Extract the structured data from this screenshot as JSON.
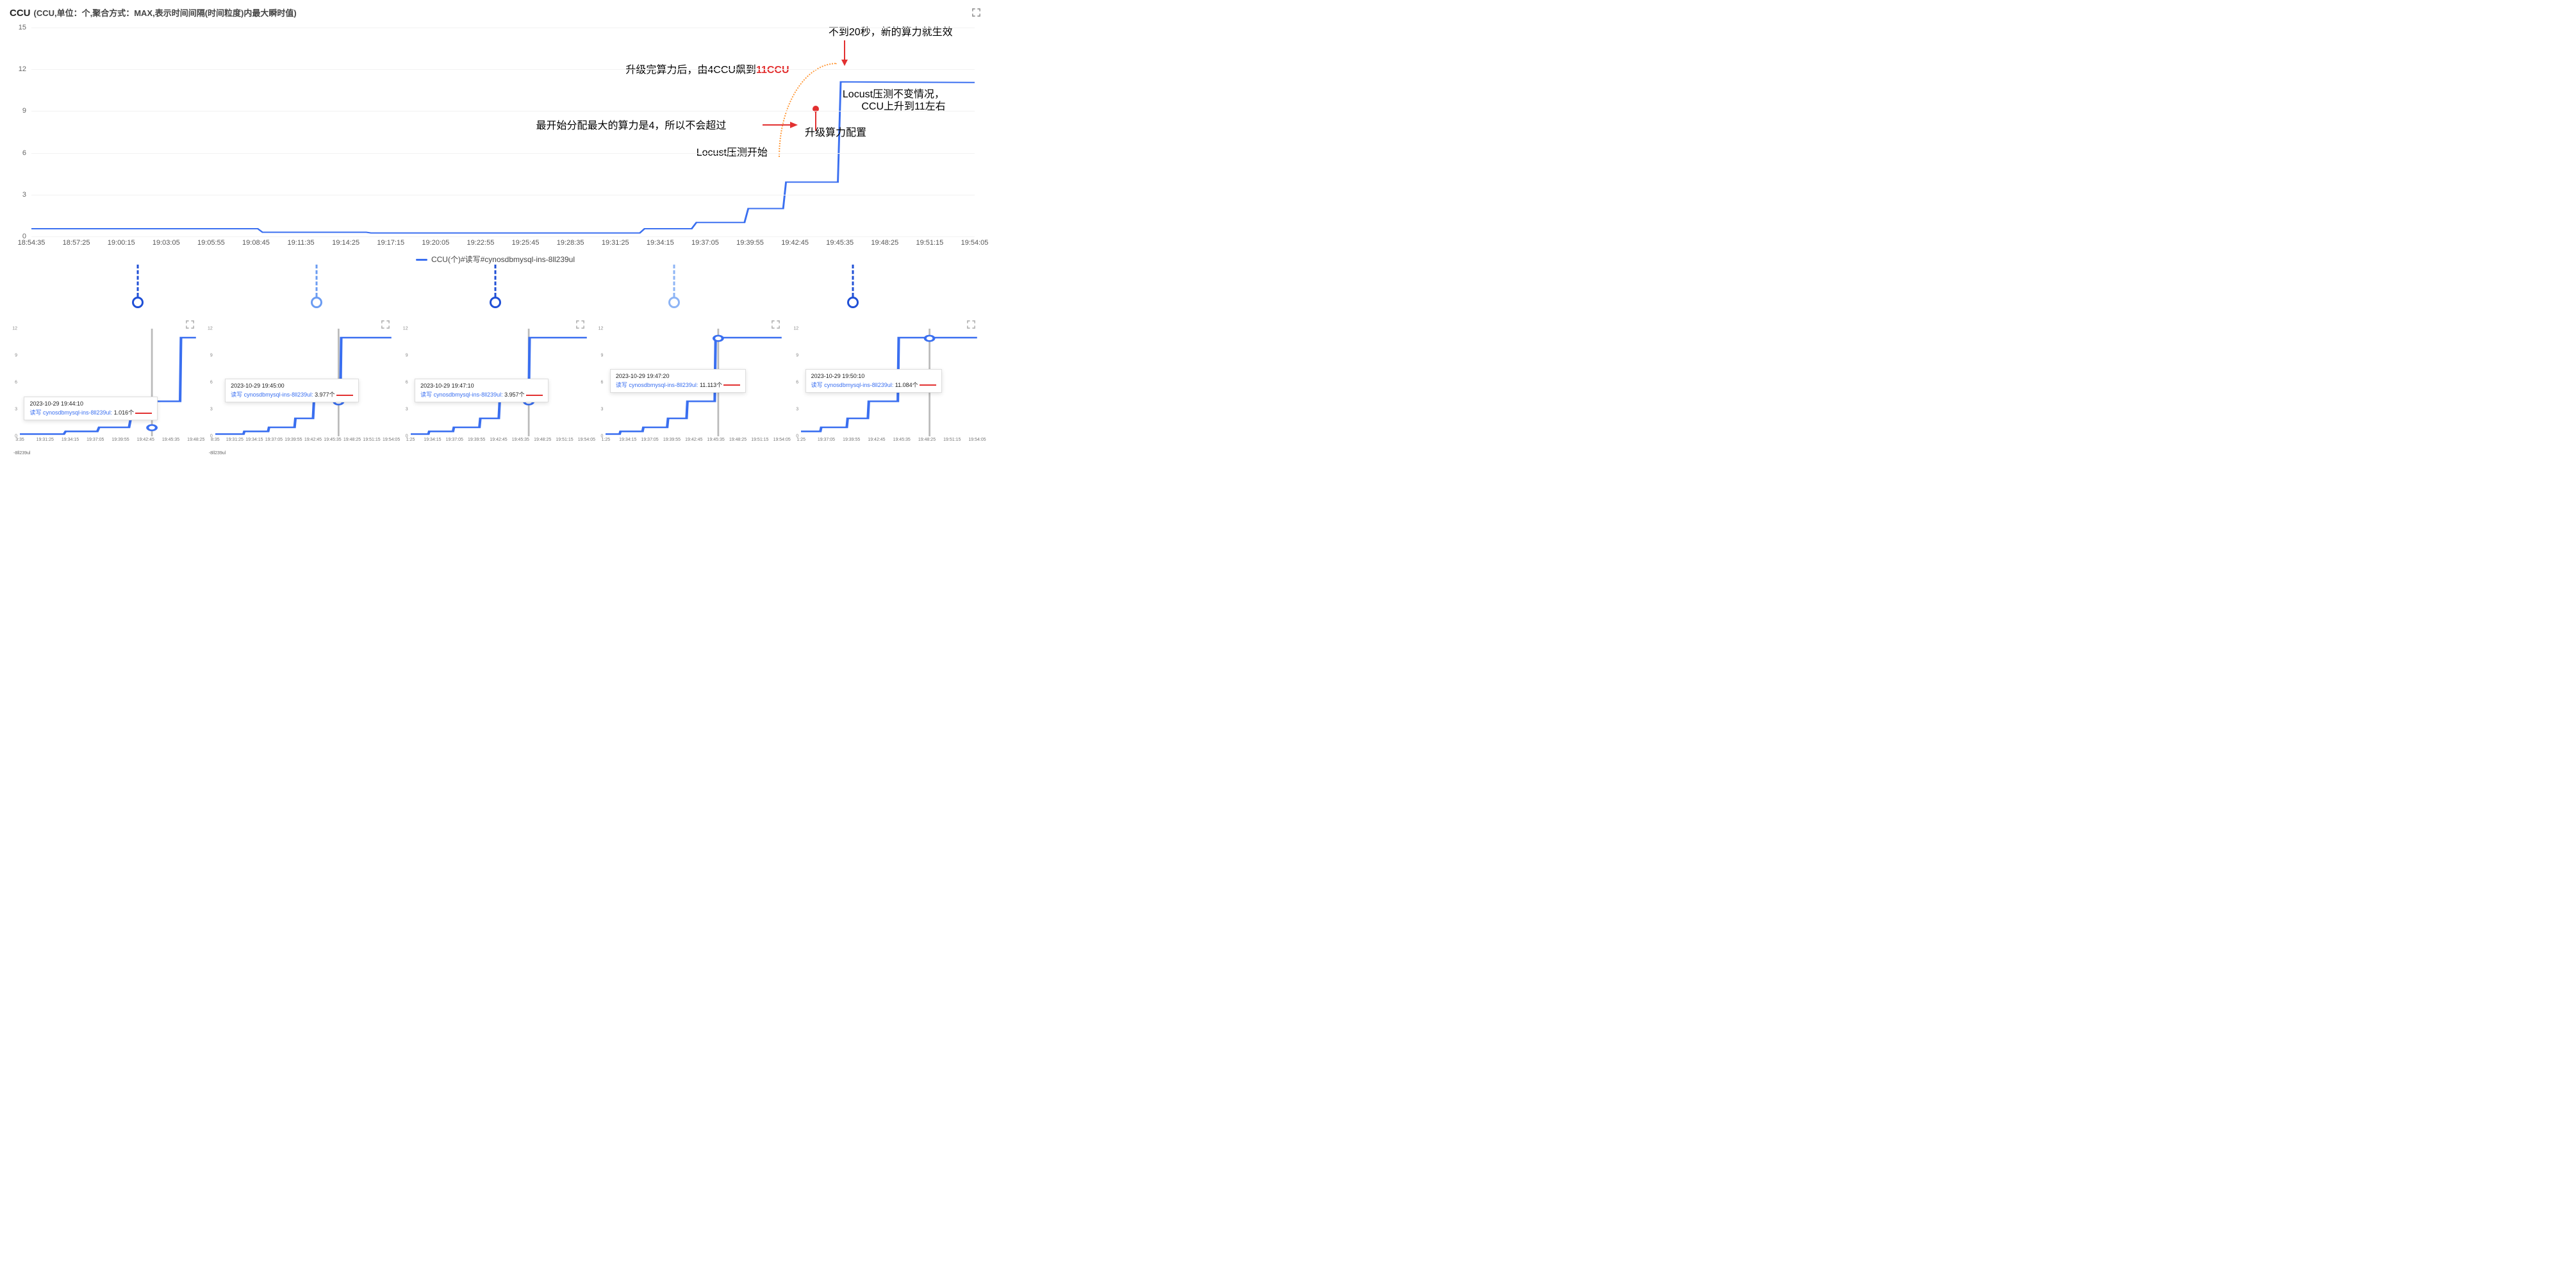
{
  "header": {
    "title_main": "CCU",
    "title_sub": "(CCU,单位：个,聚合方式：MAX,表示时间间隔(时间粒度)内最大瞬时值)"
  },
  "chart_data": {
    "type": "line",
    "title": "CCU",
    "ylabel": "",
    "xlabel": "",
    "ylim": [
      0,
      15
    ],
    "y_ticks": [
      0,
      3,
      6,
      9,
      12,
      15
    ],
    "x_ticks": [
      "18:54:35",
      "18:57:25",
      "19:00:15",
      "19:03:05",
      "19:05:55",
      "19:08:45",
      "19:11:35",
      "19:14:25",
      "19:17:15",
      "19:20:05",
      "19:22:55",
      "19:25:45",
      "19:28:35",
      "19:31:25",
      "19:34:15",
      "19:37:05",
      "19:39:55",
      "19:42:45",
      "19:45:35",
      "19:48:25",
      "19:51:15",
      "19:54:05"
    ],
    "legend": "CCU(个)#读写#cynosdbmysql-ins-8ll239ul",
    "series": [
      {
        "name": "CCU(个)#读写#cynosdbmysql-ins-8ll239ul",
        "points": [
          {
            "x": 0.0,
            "y": 0.55
          },
          {
            "x": 0.24,
            "y": 0.55
          },
          {
            "x": 0.245,
            "y": 0.3
          },
          {
            "x": 0.355,
            "y": 0.3
          },
          {
            "x": 0.36,
            "y": 0.25
          },
          {
            "x": 0.645,
            "y": 0.25
          },
          {
            "x": 0.65,
            "y": 0.55
          },
          {
            "x": 0.7,
            "y": 0.55
          },
          {
            "x": 0.705,
            "y": 1.0
          },
          {
            "x": 0.756,
            "y": 1.0
          },
          {
            "x": 0.76,
            "y": 2.0
          },
          {
            "x": 0.797,
            "y": 2.0
          },
          {
            "x": 0.8,
            "y": 3.9
          },
          {
            "x": 0.855,
            "y": 3.9
          },
          {
            "x": 0.858,
            "y": 11.1
          },
          {
            "x": 1.0,
            "y": 11.05
          }
        ]
      }
    ],
    "annotations": [
      {
        "id": "a-effect",
        "text_pre": "不到20秒，新的算力就生效",
        "x": 0.845,
        "y_top": -0.02
      },
      {
        "id": "a-jump",
        "text_pre": "升级完算力后，由4CCU飙到",
        "text_red": "11CCU",
        "x": 0.63,
        "y_top": 0.16
      },
      {
        "id": "a-initial",
        "text_pre": "最开始分配最大的算力是4，所以不会超过",
        "x": 0.535,
        "y_top": 0.425
      },
      {
        "id": "a-upgrade",
        "text_pre": "升级算力配置",
        "x": 0.82,
        "y_top": 0.46
      },
      {
        "id": "a-locust-start",
        "text_pre": "Locust压测开始",
        "x": 0.705,
        "y_top": 0.555
      },
      {
        "id": "a-locust-same",
        "text_pre": "Locust压测不变情况，",
        "x": 0.86,
        "y_top": 0.275
      },
      {
        "id": "a-locust-same2",
        "text_pre": "CCU上升到11左右",
        "x": 0.88,
        "y_top": 0.335
      }
    ]
  },
  "lollipops": [
    {
      "color": "#1f4fd6"
    },
    {
      "color": "#6b9cf2"
    },
    {
      "color": "#1f4fd6"
    },
    {
      "color": "#8db4f5"
    },
    {
      "color": "#1f4fd6"
    }
  ],
  "thumbs": [
    {
      "tooltip_time": "2023-10-29 19:44:10",
      "tooltip_series": "读写 cynosdbmysql-ins-8ll239ul:",
      "tooltip_val": "1.016个",
      "cursor_x": 0.75,
      "cursor_y": 0.92,
      "legend": "-8ll239ul",
      "x_ticks": [
        "3:35",
        "19:31:25",
        "19:34:15",
        "19:37:05",
        "19:39:55",
        "19:42:45",
        "19:45:35",
        "19:48:25"
      ],
      "y_ticks": [
        0,
        3,
        6,
        9,
        12
      ],
      "line": [
        {
          "x": 0,
          "y": 0.25
        },
        {
          "x": 0.25,
          "y": 0.25
        },
        {
          "x": 0.26,
          "y": 0.55
        },
        {
          "x": 0.44,
          "y": 0.55
        },
        {
          "x": 0.45,
          "y": 1.0
        },
        {
          "x": 0.62,
          "y": 1.0
        },
        {
          "x": 0.63,
          "y": 2.0
        },
        {
          "x": 0.75,
          "y": 2.0
        },
        {
          "x": 0.755,
          "y": 3.9
        },
        {
          "x": 0.91,
          "y": 3.9
        },
        {
          "x": 0.915,
          "y": 11.0
        },
        {
          "x": 1.0,
          "y": 11.0
        }
      ],
      "tooltip_pos": {
        "left": 0.07,
        "top": 0.58
      }
    },
    {
      "tooltip_time": "2023-10-29 19:45:00",
      "tooltip_series": "读写 cynosdbmysql-ins-8ll239ul:",
      "tooltip_val": "3.977个",
      "cursor_x": 0.7,
      "cursor_y": 0.68,
      "legend": "-8ll239ul",
      "x_ticks": [
        "8:35",
        "19:31:25",
        "19:34:15",
        "19:37:05",
        "19:39:55",
        "19:42:45",
        "19:45:35",
        "19:48:25",
        "19:51:15",
        "19:54:05"
      ],
      "y_ticks": [
        0,
        3,
        6,
        9,
        12
      ],
      "line": [
        {
          "x": 0,
          "y": 0.25
        },
        {
          "x": 0.16,
          "y": 0.25
        },
        {
          "x": 0.165,
          "y": 0.55
        },
        {
          "x": 0.3,
          "y": 0.55
        },
        {
          "x": 0.305,
          "y": 1.0
        },
        {
          "x": 0.45,
          "y": 1.0
        },
        {
          "x": 0.455,
          "y": 2.0
        },
        {
          "x": 0.555,
          "y": 2.0
        },
        {
          "x": 0.56,
          "y": 3.9
        },
        {
          "x": 0.71,
          "y": 3.9
        },
        {
          "x": 0.715,
          "y": 11.0
        },
        {
          "x": 1.0,
          "y": 11.0
        }
      ],
      "tooltip_pos": {
        "left": 0.1,
        "top": 0.45
      }
    },
    {
      "tooltip_time": "2023-10-29 19:47:10",
      "tooltip_series": "读写 cynosdbmysql-ins-8ll239ul:",
      "tooltip_val": "3.957个",
      "cursor_x": 0.67,
      "cursor_y": 0.68,
      "legend": "",
      "x_ticks": [
        "1:25",
        "19:34:15",
        "19:37:05",
        "19:39:55",
        "19:42:45",
        "19:45:35",
        "19:48:25",
        "19:51:15",
        "19:54:05"
      ],
      "y_ticks": [
        0,
        3,
        6,
        9,
        12
      ],
      "line": [
        {
          "x": 0,
          "y": 0.25
        },
        {
          "x": 0.1,
          "y": 0.25
        },
        {
          "x": 0.105,
          "y": 0.55
        },
        {
          "x": 0.24,
          "y": 0.55
        },
        {
          "x": 0.245,
          "y": 1.0
        },
        {
          "x": 0.39,
          "y": 1.0
        },
        {
          "x": 0.395,
          "y": 2.0
        },
        {
          "x": 0.5,
          "y": 2.0
        },
        {
          "x": 0.505,
          "y": 3.9
        },
        {
          "x": 0.67,
          "y": 3.9
        },
        {
          "x": 0.675,
          "y": 11.0
        },
        {
          "x": 1.0,
          "y": 11.0
        }
      ],
      "tooltip_pos": {
        "left": 0.07,
        "top": 0.45
      }
    },
    {
      "tooltip_time": "2023-10-29 19:47:20",
      "tooltip_series": "读写 cynosdbmysql-ins-8ll239ul:",
      "tooltip_val": "11.113个",
      "cursor_x": 0.64,
      "cursor_y": 0.09,
      "legend": "",
      "x_ticks": [
        "1:25",
        "19:34:15",
        "19:37:05",
        "19:39:55",
        "19:42:45",
        "19:45:35",
        "19:48:25",
        "19:51:15",
        "19:54:05"
      ],
      "y_ticks": [
        0,
        3,
        6,
        9,
        12
      ],
      "line": [
        {
          "x": 0,
          "y": 0.25
        },
        {
          "x": 0.08,
          "y": 0.25
        },
        {
          "x": 0.085,
          "y": 0.55
        },
        {
          "x": 0.21,
          "y": 0.55
        },
        {
          "x": 0.215,
          "y": 1.0
        },
        {
          "x": 0.35,
          "y": 1.0
        },
        {
          "x": 0.355,
          "y": 2.0
        },
        {
          "x": 0.46,
          "y": 2.0
        },
        {
          "x": 0.465,
          "y": 3.9
        },
        {
          "x": 0.62,
          "y": 3.9
        },
        {
          "x": 0.625,
          "y": 11.0
        },
        {
          "x": 1.0,
          "y": 11.0
        }
      ],
      "tooltip_pos": {
        "left": 0.07,
        "top": 0.38
      }
    },
    {
      "tooltip_time": "2023-10-29 19:50:10",
      "tooltip_series": "读写 cynosdbmysql-ins-8ll239ul:",
      "tooltip_val": "11.084个",
      "cursor_x": 0.73,
      "cursor_y": 0.09,
      "legend": "",
      "x_ticks": [
        "1:25",
        "19:37:05",
        "19:39:55",
        "19:42:45",
        "19:45:35",
        "19:48:25",
        "19:51:15",
        "19:54:05"
      ],
      "y_ticks": [
        0,
        3,
        6,
        9,
        12
      ],
      "line": [
        {
          "x": 0,
          "y": 0.55
        },
        {
          "x": 0.11,
          "y": 0.55
        },
        {
          "x": 0.115,
          "y": 1.0
        },
        {
          "x": 0.26,
          "y": 1.0
        },
        {
          "x": 0.265,
          "y": 2.0
        },
        {
          "x": 0.38,
          "y": 2.0
        },
        {
          "x": 0.385,
          "y": 3.9
        },
        {
          "x": 0.55,
          "y": 3.9
        },
        {
          "x": 0.555,
          "y": 11.0
        },
        {
          "x": 1.0,
          "y": 11.0
        }
      ],
      "tooltip_pos": {
        "left": 0.07,
        "top": 0.38
      }
    }
  ]
}
